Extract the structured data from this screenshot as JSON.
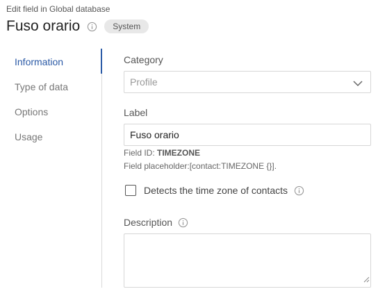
{
  "header": {
    "subtitle": "Edit field in Global database",
    "title": "Fuso orario",
    "badge": "System"
  },
  "sidebar": {
    "items": [
      {
        "label": "Information",
        "active": true
      },
      {
        "label": "Type of data",
        "active": false
      },
      {
        "label": "Options",
        "active": false
      },
      {
        "label": "Usage",
        "active": false
      }
    ]
  },
  "form": {
    "category": {
      "label": "Category",
      "value": "Profile"
    },
    "label_field": {
      "label": "Label",
      "value": "Fuso orario"
    },
    "field_id_prefix": "Field ID: ",
    "field_id": "TIMEZONE",
    "field_placeholder": "Field placeholder:[contact:TIMEZONE {}].",
    "checkbox": {
      "label": "Detects the time zone of contacts",
      "checked": false
    },
    "description": {
      "label": "Description",
      "value": ""
    }
  },
  "colors": {
    "accent": "#2b5aa6",
    "border": "#d6d6d6",
    "badge_bg": "#e8e8e8"
  },
  "icons": [
    "info-icon",
    "chevron-down-icon",
    "resize-handle-icon"
  ]
}
